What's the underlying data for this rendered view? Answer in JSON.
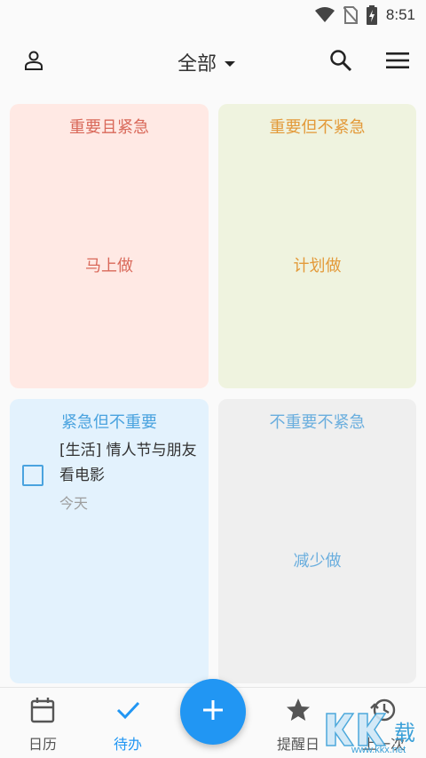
{
  "status_bar": {
    "time": "8:51"
  },
  "app_bar": {
    "filter_label": "全部"
  },
  "quadrants": [
    {
      "title": "重要且紧急",
      "hint": "马上做",
      "color": "#d9695a",
      "background": "#ffe9e4"
    },
    {
      "title": "重要但不紧急",
      "hint": "计划做",
      "color": "#e39a3a",
      "background": "#eff3df"
    },
    {
      "title": "紧急但不重要",
      "color": "#4aa3df",
      "background": "#e3f2fd",
      "tasks": [
        {
          "title": "[生活] 情人节与朋友看电影",
          "date": "今天",
          "checked": false
        }
      ]
    },
    {
      "title": "不重要不紧急",
      "hint": "减少做",
      "color": "#6aaede",
      "background": "#efefef"
    }
  ],
  "bottom_nav": {
    "items": [
      {
        "label": "日历",
        "icon": "calendar-icon"
      },
      {
        "label": "待办",
        "icon": "check-icon",
        "active": true
      },
      {
        "label": "提醒日",
        "icon": "star-icon"
      },
      {
        "label": "上一次",
        "icon": "history-icon"
      }
    ],
    "fab_icon": "plus-icon",
    "accent_color": "#2196f3"
  },
  "watermark": {
    "text": "www.kkx.net"
  }
}
